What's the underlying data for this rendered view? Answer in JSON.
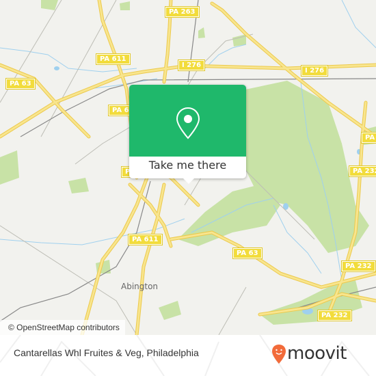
{
  "map": {
    "road_labels": [
      {
        "id": "pa263",
        "text": "PA 263"
      },
      {
        "id": "pa611-top",
        "text": "PA 611"
      },
      {
        "id": "i276-left",
        "text": "I 276"
      },
      {
        "id": "i276-right",
        "text": "I 276"
      },
      {
        "id": "pa63-left",
        "text": "PA 63"
      },
      {
        "id": "pa6-partial",
        "text": "PA 6"
      },
      {
        "id": "pa-partial-right",
        "text": "PA"
      },
      {
        "id": "pa232-mid",
        "text": "PA 232"
      },
      {
        "id": "pa611-bottom",
        "text": "PA 611"
      },
      {
        "id": "pa63-right",
        "text": "PA 63"
      },
      {
        "id": "pa232-lower",
        "text": "PA 232"
      },
      {
        "id": "pa232-bottom",
        "text": "PA 232"
      },
      {
        "id": "p-partial",
        "text": "P"
      }
    ],
    "town_label": "Abington",
    "attribution": "© OpenStreetMap contributors",
    "colors": {
      "background": "#f2f2ee",
      "road": "#f5dc6a",
      "park": "#c8e2a6",
      "water": "#9fd0ee",
      "rail": "#888888"
    }
  },
  "popup": {
    "icon": "location-pin-icon",
    "button_label": "Take me there",
    "accent_color": "#1fb86b"
  },
  "footer": {
    "place_name": "Cantarellas Whl Fruites & Veg, Philadelphia",
    "logo_text": "moovit",
    "logo_color": "#f26b3a"
  }
}
